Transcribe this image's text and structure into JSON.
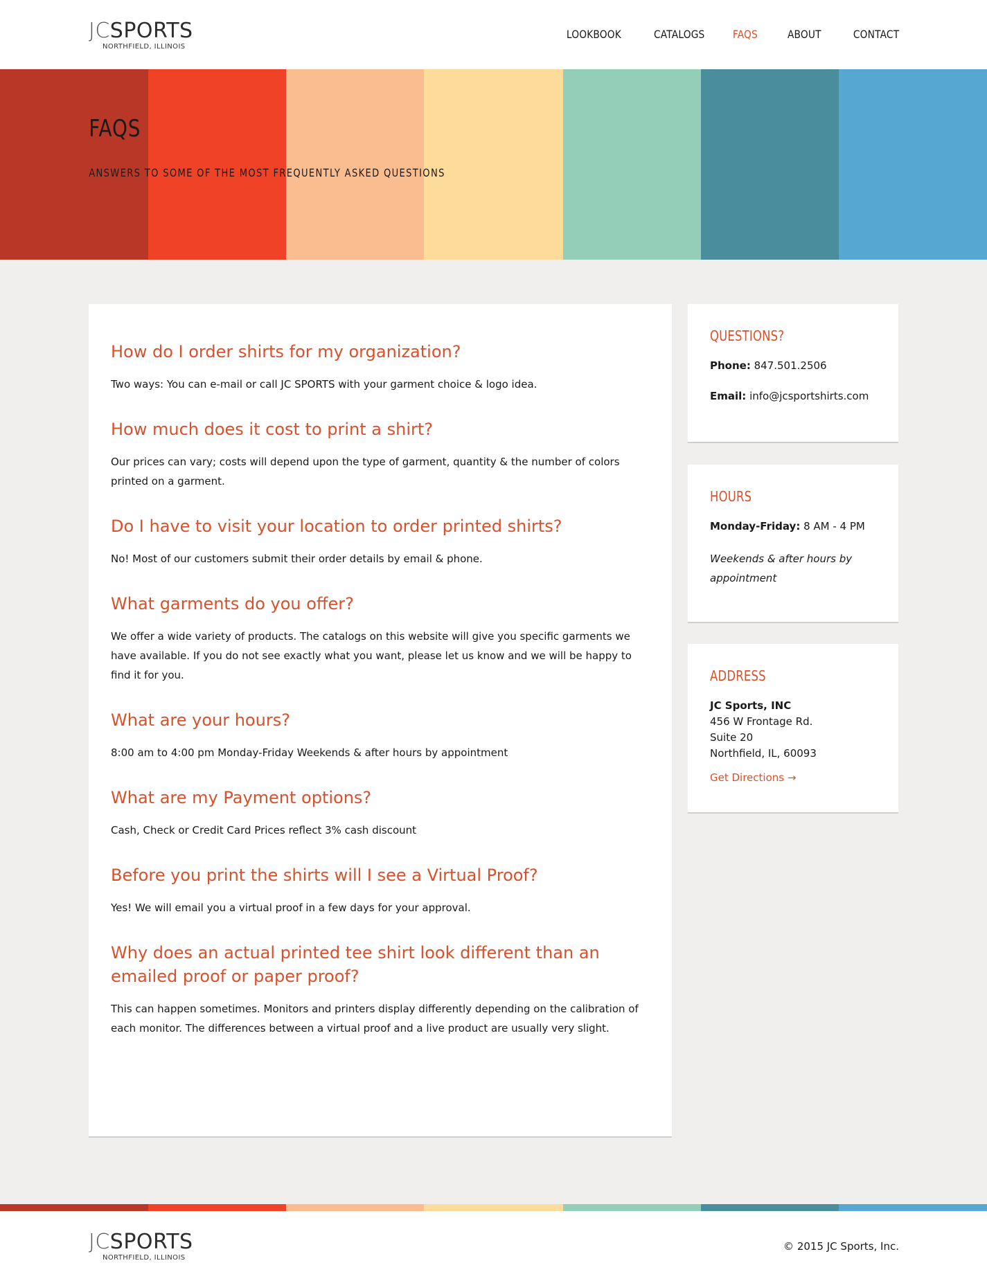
{
  "header": {
    "logo_main_a": "JC",
    "logo_main_b": "SPORTS",
    "logo_sub": "NORTHFIELD, ILLINOIS",
    "nav": [
      {
        "label": "LOOKBOOK"
      },
      {
        "label": "CATALOGS"
      },
      {
        "label": "FAQS"
      },
      {
        "label": "ABOUT"
      },
      {
        "label": "CONTACT"
      }
    ]
  },
  "hero": {
    "title": "FAQS",
    "subtitle": "ANSWERS TO SOME OF THE MOST FREQUENTLY ASKED QUESTIONS",
    "stripe_colors": [
      "#b93727",
      "#ef4227",
      "#fabd8f",
      "#fddc9b",
      "#94ceb9",
      "#4a8d9d",
      "#56a8d2"
    ]
  },
  "faqs": [
    {
      "q": "How do I order shirts for my organization?",
      "a": "Two ways: You can e-mail or call JC SPORTS with your garment choice & logo idea."
    },
    {
      "q": "How much does it cost to print a shirt?",
      "a": "Our prices can vary; costs will depend upon the type of garment, quantity & the number of colors printed on a garment."
    },
    {
      "q": "Do I have to visit your location to order printed shirts?",
      "a": "No! Most of our customers submit their order details by email & phone."
    },
    {
      "q": "What garments do you offer?",
      "a": "We offer a wide variety of products. The catalogs on this website will give you specific garments we have available. If you do not see exactly what you want, please let us know and we will be happy to find it for you."
    },
    {
      "q": "What are your hours?",
      "a": "8:00 am to 4:00 pm Monday-Friday Weekends & after hours by appointment"
    },
    {
      "q": "What are my Payment options?",
      "a": "Cash, Check or Credit Card Prices reflect 3% cash discount"
    },
    {
      "q": "Before you print the shirts will I see a Virtual Proof?",
      "a": "Yes! We will email you a virtual proof in a few days for your approval."
    },
    {
      "q": "Why does an actual printed tee shirt look different than an emailed proof or paper proof?",
      "a": "This can happen sometimes. Monitors and printers display differently depending on the calibration of each monitor. The differences between a virtual proof and a live product are usually very slight."
    }
  ],
  "sidebar": {
    "questions": {
      "title": "QUESTIONS?",
      "phone_label": "Phone:",
      "phone": "847.501.2506",
      "email_label": "Email:",
      "email": "info@jcsportshirts.com"
    },
    "hours": {
      "title": "HOURS",
      "weekday_label": "Monday-Friday:",
      "weekday": "8 AM - 4 PM",
      "note": "Weekends & after hours by appointment"
    },
    "address": {
      "title": "ADDRESS",
      "company": "JC Sports, INC",
      "line1": "456 W Frontage Rd.",
      "line2": "Suite 20",
      "line3": "Northfield, IL, 60093",
      "directions": "Get Directions →"
    }
  },
  "footer": {
    "copyright": "© 2015  JC Sports, Inc."
  },
  "colors": {
    "accent": "#d9512c",
    "background": "#f0efed"
  }
}
